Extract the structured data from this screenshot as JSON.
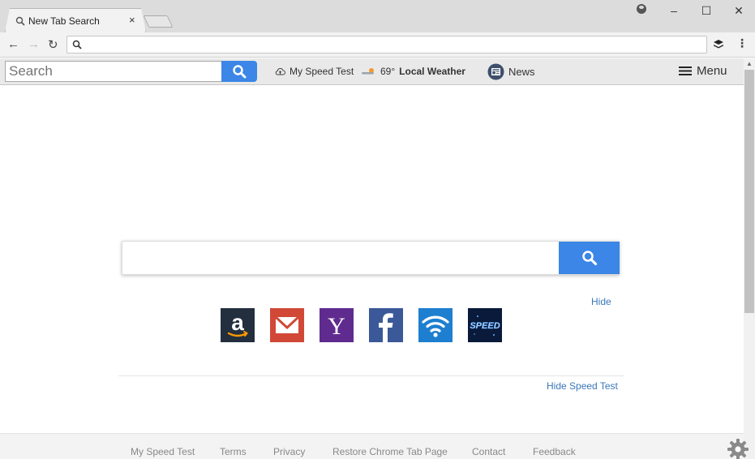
{
  "browser": {
    "tab_title": "New Tab Search",
    "tab_close": "×",
    "minimize": "–",
    "maximize": "☐",
    "close": "✕",
    "back": "←",
    "forward": "→",
    "reload": "↻",
    "menu_dots": "⋮",
    "address_value": ""
  },
  "extbar": {
    "search_placeholder": "Search",
    "speed_test": "My Speed Test",
    "weather_temp": "69°",
    "weather_label": "Local Weather",
    "news": "News",
    "menu": "Menu"
  },
  "main": {
    "search_value": "",
    "hide": "Hide",
    "hide_speed_test": "Hide Speed Test",
    "tiles": [
      {
        "name": "amazon",
        "color": "#232f3e"
      },
      {
        "name": "gmail",
        "color": "#d14836"
      },
      {
        "name": "yahoo",
        "color": "#5f2b8f"
      },
      {
        "name": "facebook",
        "color": "#3b5998"
      },
      {
        "name": "wifi",
        "color": "#1e7fd0"
      },
      {
        "name": "speed",
        "color": "#0a1a3a"
      }
    ]
  },
  "footer": {
    "links": [
      "My Speed Test",
      "Terms",
      "Privacy",
      "Restore Chrome Tab Page",
      "Contact",
      "Feedback"
    ]
  },
  "colors": {
    "accent": "#3b86e6",
    "link": "#3a78b8"
  }
}
